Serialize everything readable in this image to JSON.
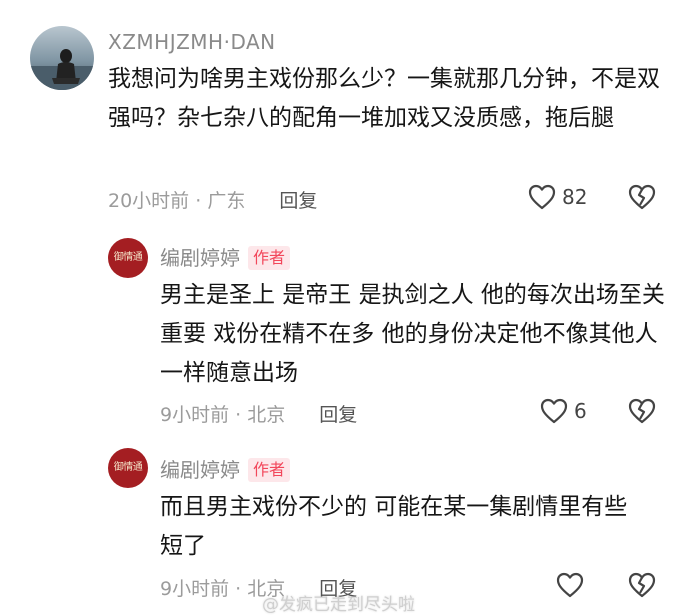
{
  "comments": [
    {
      "username": "XZMHJZMH·DAN",
      "text": "我想问为啥男主戏份那么少？一集就那几分钟，不是双强吗？杂七杂八的配角一堆加戏又没质感，拖后腿",
      "time": "20小时前",
      "location": "广东",
      "reply_label": "回复",
      "likes": "82"
    },
    {
      "username": "编剧婷婷",
      "badge": "作者",
      "text": "男主是圣上 是帝王 是执剑之人 他的每次出场至关重要 戏份在精不在多 他的身份决定他不像其他人一样随意出场",
      "time": "9小时前",
      "location": "北京",
      "reply_label": "回复",
      "likes": "6"
    },
    {
      "username": "编剧婷婷",
      "badge": "作者",
      "text": "而且男主戏份不少的 可能在某一集剧情里有些短了",
      "time": "9小时前",
      "location": "北京",
      "reply_label": "回复",
      "likes": ""
    }
  ],
  "avatar_logo_text": "御情通",
  "watermark": "@发疯已走到尽头啦",
  "colors": {
    "badge_text": "#f2475b",
    "badge_bg": "#fde7ea",
    "avatar_logo_bg": "#a41e22"
  },
  "icons": {
    "like": "heart-outline-icon",
    "dislike": "broken-heart-icon"
  }
}
